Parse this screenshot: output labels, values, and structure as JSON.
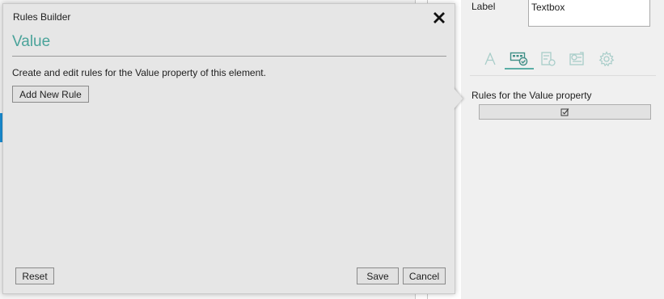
{
  "dialog": {
    "title": "Rules Builder",
    "heading": "Value",
    "description": "Create and edit rules for the Value property of this element.",
    "add_rule_label": "Add New Rule",
    "reset_label": "Reset",
    "save_label": "Save",
    "cancel_label": "Cancel",
    "close_icon": "close-icon"
  },
  "properties": {
    "label_caption": "Label",
    "label_value": "Textbox",
    "tabs": [
      {
        "icon": "text-icon",
        "active": false
      },
      {
        "icon": "value-rules-icon",
        "active": true
      },
      {
        "icon": "form-settings-icon",
        "active": false
      },
      {
        "icon": "image-checklist-icon",
        "active": false
      },
      {
        "icon": "gear-icon",
        "active": false
      }
    ],
    "rules_caption": "Rules for the Value property",
    "rules_button_icon": "edit-checkbox-icon"
  },
  "colors": {
    "accent": "#4aa39a",
    "editor_blue": "#1a8fd6"
  }
}
